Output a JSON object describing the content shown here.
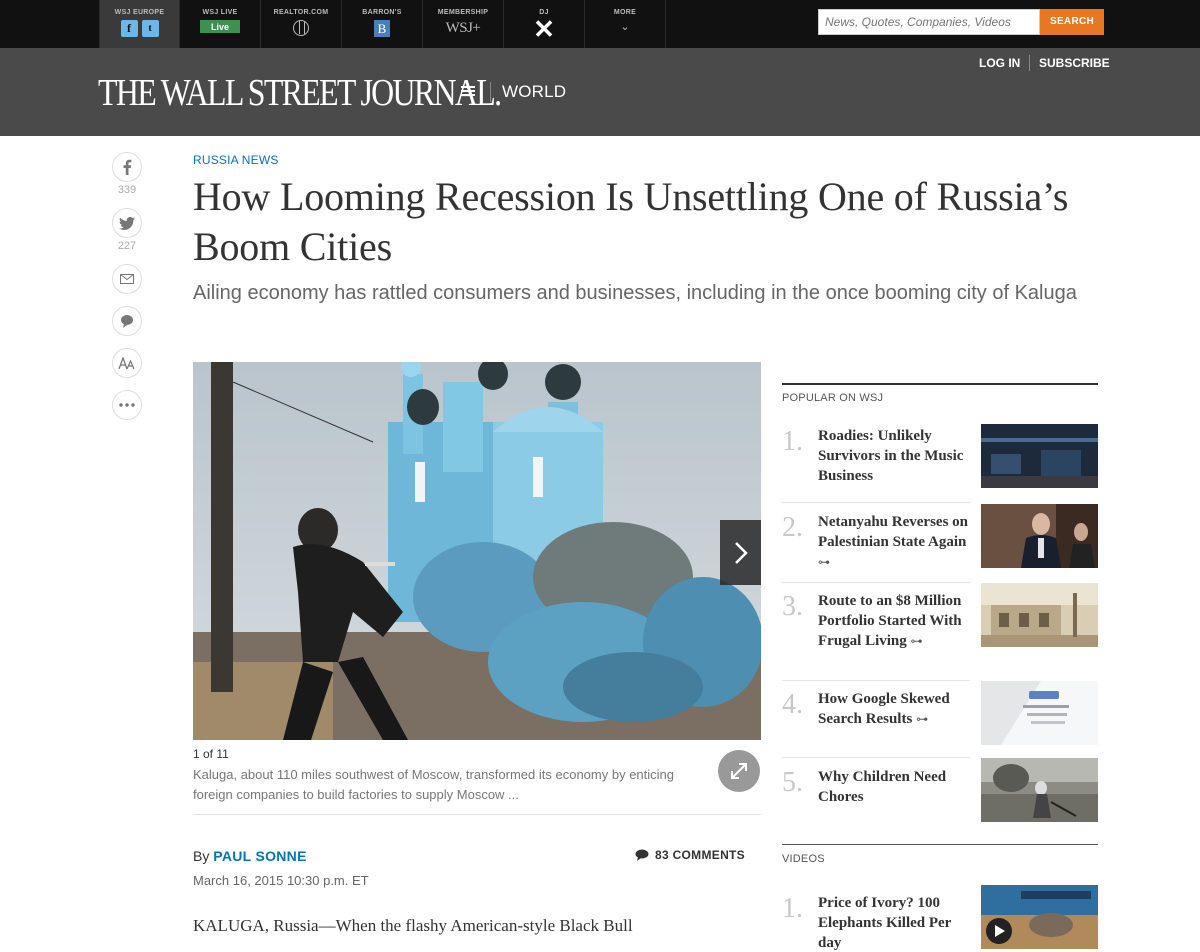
{
  "topnav": {
    "items": [
      {
        "label": "WSJ EUROPE",
        "icon": "facebook-twitter-icons"
      },
      {
        "label": "WSJ LIVE",
        "badge": "Live"
      },
      {
        "label": "REALTOR.COM",
        "icon": "globe-icon"
      },
      {
        "label": "BARRON'S",
        "icon_text": "B"
      },
      {
        "label": "MEMBERSHIP",
        "icon_text": "WSJ+"
      },
      {
        "label": "DJ",
        "icon_text": "✕"
      },
      {
        "label": "MORE",
        "icon_text": "⌄"
      }
    ],
    "fb_glyph": "f",
    "tw_glyph": "t",
    "search_placeholder": "News, Quotes, Companies, Videos",
    "search_button": "SEARCH"
  },
  "masthead": {
    "logo": "THE WALL STREET JOURNAL.",
    "section": "WORLD",
    "login": "LOG IN",
    "subscribe": "SUBSCRIBE"
  },
  "share": {
    "facebook_count": "339",
    "twitter_count": "227"
  },
  "article": {
    "kicker": "RUSSIA NEWS",
    "headline": "How Looming Recession Is Unsettling One of Russia’s Boom Cities",
    "dek": "Ailing economy has rattled consumers and businesses, including in the once booming city of Kaluga",
    "slide_counter": "1 of 11",
    "caption": "Kaluga, about 110 miles southwest of Moscow, transformed its economy by enticing foreign companies to build factories to supply Moscow ...",
    "byline_prefix": "By",
    "author": "PAUL SONNE",
    "comments": "83 COMMENTS",
    "timestamp": "March 16, 2015 10:30 p.m. ET",
    "body_start": "KALUGA, Russia—When the flashy American-style Black Bull"
  },
  "sidebar": {
    "popular_title": "POPULAR ON WSJ",
    "popular": [
      {
        "num": "1.",
        "title": "Roadies: Unlikely Survivors in the Music Business",
        "key": false
      },
      {
        "num": "2.",
        "title": "Netanyahu Reverses on Palestinian State Again",
        "key": true
      },
      {
        "num": "3.",
        "title": "Route to an $8 Million Portfolio Started With Frugal Living",
        "key": true
      },
      {
        "num": "4.",
        "title": "How Google Skewed Search Results",
        "key": true
      },
      {
        "num": "5.",
        "title": "Why Children Need Chores",
        "key": false
      }
    ],
    "key_glyph": "⊶",
    "videos_title": "VIDEOS",
    "videos": [
      {
        "num": "1.",
        "title": "Price of Ivory? 100 Elephants Killed Per day"
      }
    ]
  },
  "colors": {
    "accent_blue": "#0274b6",
    "search_orange": "#e87722",
    "masthead_gray": "#4a4a4a",
    "topbar_black": "#111111"
  }
}
